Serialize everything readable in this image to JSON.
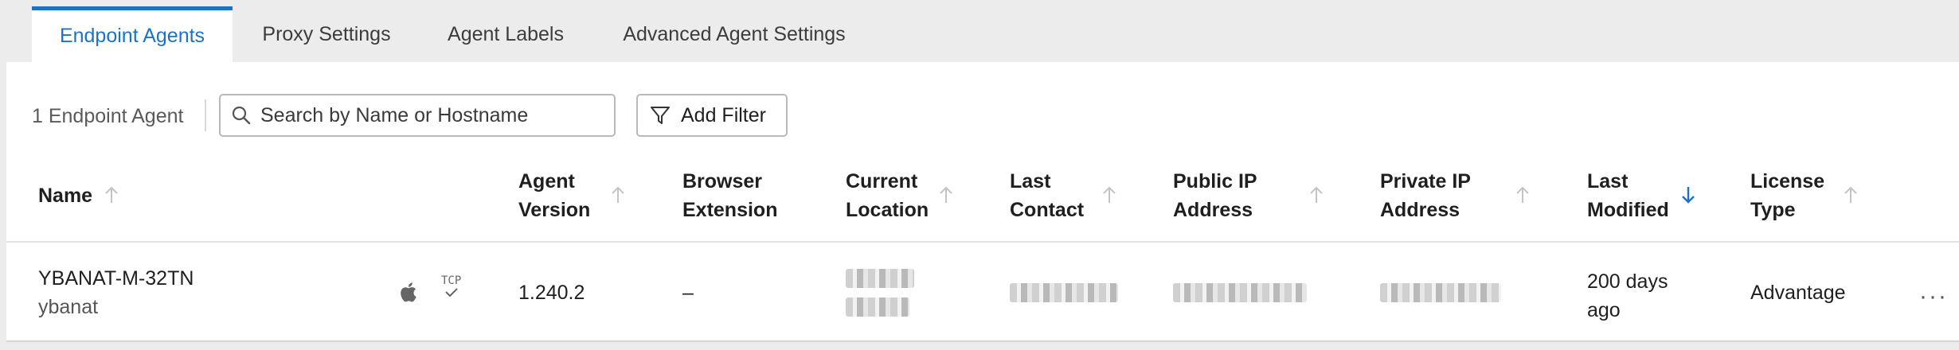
{
  "tabs": [
    {
      "label": "Endpoint Agents",
      "active": true
    },
    {
      "label": "Proxy Settings",
      "active": false
    },
    {
      "label": "Agent Labels",
      "active": false
    },
    {
      "label": "Advanced Agent Settings",
      "active": false
    }
  ],
  "toolbar": {
    "count_label": "1 Endpoint Agent",
    "search_placeholder": "Search by Name or Hostname",
    "filter_label": "Add Filter"
  },
  "columns": [
    {
      "label": "Name",
      "sort": "up"
    },
    {
      "label": "Agent\nVersion",
      "sort": "up"
    },
    {
      "label": "Browser\nExtension",
      "sort": "none"
    },
    {
      "label": "Current\nLocation",
      "sort": "up"
    },
    {
      "label": "Last\nContact",
      "sort": "up"
    },
    {
      "label": "Public IP\nAddress",
      "sort": "up"
    },
    {
      "label": "Private IP\nAddress",
      "sort": "up"
    },
    {
      "label": "Last\nModified",
      "sort": "down-active"
    },
    {
      "label": "License\nType",
      "sort": "up"
    }
  ],
  "rows": [
    {
      "name": "YBANAT-M-32TN",
      "user": "ybanat",
      "platform_icon": "apple-icon",
      "protocol_icon": "tcp-icon",
      "protocol_text": "TCP",
      "agent_version": "1.240.2",
      "browser_extension": "–",
      "current_location": "",
      "last_contact": "",
      "public_ip": "",
      "private_ip": "",
      "last_modified": "200 days\nago",
      "license_type": "Advantage",
      "more_label": "···"
    }
  ],
  "colors": {
    "accent": "#1a73c8",
    "page_bg": "#ececec",
    "panel_bg": "#ffffff",
    "sort_inactive": "#c4c4c4"
  }
}
